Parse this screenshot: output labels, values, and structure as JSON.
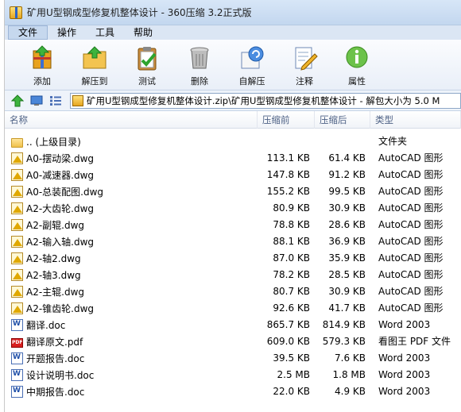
{
  "window": {
    "title": "矿用U型钢成型修复机整体设计 - 360压缩 3.2正式版"
  },
  "menu": [
    {
      "label": "文件",
      "active": true
    },
    {
      "label": "操作",
      "active": false
    },
    {
      "label": "工具",
      "active": false
    },
    {
      "label": "帮助",
      "active": false
    }
  ],
  "toolbar": [
    {
      "label": "添加",
      "icon": "add-archive-icon"
    },
    {
      "label": "解压到",
      "icon": "extract-to-icon"
    },
    {
      "label": "测试",
      "icon": "test-clipboard-icon"
    },
    {
      "label": "删除",
      "icon": "delete-trash-icon"
    },
    {
      "label": "自解压",
      "icon": "self-extract-icon"
    },
    {
      "label": "注释",
      "icon": "comment-icon"
    },
    {
      "label": "属性",
      "icon": "info-icon"
    }
  ],
  "address": {
    "path": "矿用U型钢成型修复机整体设计.zip\\矿用U型钢成型修复机整体设计 - 解包大小为 5.0 M"
  },
  "columns": {
    "name": "名称",
    "size": "压缩前",
    "packed": "压缩后",
    "type": "类型"
  },
  "files": [
    {
      "name": ".. (上级目录)",
      "size": "",
      "packed": "",
      "type": "文件夹",
      "icon": "folder"
    },
    {
      "name": "A0-摆动梁.dwg",
      "size": "113.1 KB",
      "packed": "61.4 KB",
      "type": "AutoCAD 图形",
      "icon": "dwg"
    },
    {
      "name": "A0-减速器.dwg",
      "size": "147.8 KB",
      "packed": "91.2 KB",
      "type": "AutoCAD 图形",
      "icon": "dwg"
    },
    {
      "name": "A0-总装配图.dwg",
      "size": "155.2 KB",
      "packed": "99.5 KB",
      "type": "AutoCAD 图形",
      "icon": "dwg"
    },
    {
      "name": "A2-大齿轮.dwg",
      "size": "80.9 KB",
      "packed": "30.9 KB",
      "type": "AutoCAD 图形",
      "icon": "dwg"
    },
    {
      "name": "A2-副辊.dwg",
      "size": "78.8 KB",
      "packed": "28.6 KB",
      "type": "AutoCAD 图形",
      "icon": "dwg"
    },
    {
      "name": "A2-输入轴.dwg",
      "size": "88.1 KB",
      "packed": "36.9 KB",
      "type": "AutoCAD 图形",
      "icon": "dwg"
    },
    {
      "name": "A2-轴2.dwg",
      "size": "87.0 KB",
      "packed": "35.9 KB",
      "type": "AutoCAD 图形",
      "icon": "dwg"
    },
    {
      "name": "A2-轴3.dwg",
      "size": "78.2 KB",
      "packed": "28.5 KB",
      "type": "AutoCAD 图形",
      "icon": "dwg"
    },
    {
      "name": "A2-主辊.dwg",
      "size": "80.7 KB",
      "packed": "30.9 KB",
      "type": "AutoCAD 图形",
      "icon": "dwg"
    },
    {
      "name": "A2-锥齿轮.dwg",
      "size": "92.6 KB",
      "packed": "41.7 KB",
      "type": "AutoCAD 图形",
      "icon": "dwg"
    },
    {
      "name": "翻译.doc",
      "size": "865.7 KB",
      "packed": "814.9 KB",
      "type": "Word 2003",
      "icon": "doc"
    },
    {
      "name": "翻译原文.pdf",
      "size": "609.0 KB",
      "packed": "579.3 KB",
      "type": "看图王 PDF 文件",
      "icon": "pdf"
    },
    {
      "name": "开题报告.doc",
      "size": "39.5 KB",
      "packed": "7.6 KB",
      "type": "Word 2003",
      "icon": "doc"
    },
    {
      "name": "设计说明书.doc",
      "size": "2.5 MB",
      "packed": "1.8 MB",
      "type": "Word 2003",
      "icon": "doc"
    },
    {
      "name": "中期报告.doc",
      "size": "22.0 KB",
      "packed": "4.9 KB",
      "type": "Word 2003",
      "icon": "doc"
    }
  ]
}
